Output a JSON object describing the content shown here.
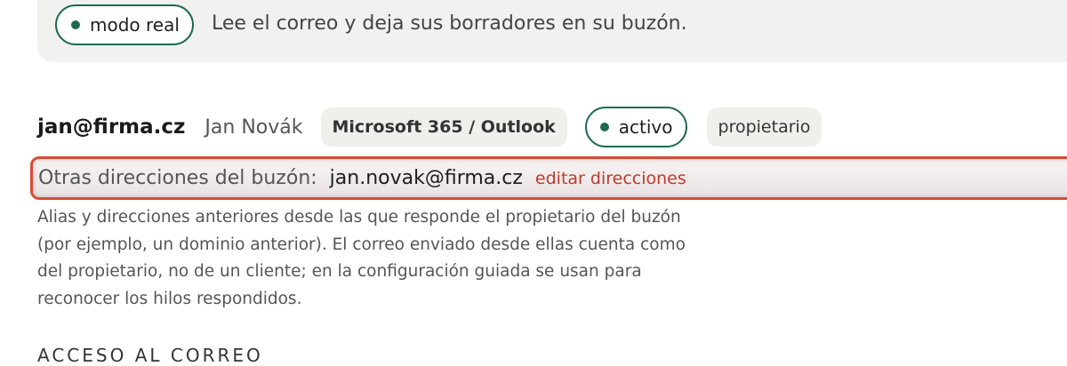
{
  "banner": {
    "mode_label": "modo real",
    "description": "Lee el correo y deja sus borradores en su buzón."
  },
  "account": {
    "email": "jan@firma.cz",
    "owner_name": "Jan Novák",
    "provider": "Microsoft 365 / Outlook",
    "status": "activo",
    "role": "propietario"
  },
  "aliases": {
    "label": "Otras direcciones del buzón:",
    "value": "jan.novak@firma.cz",
    "edit_label": "editar direcciones",
    "help_text": "Alias y direcciones anteriores desde las que responde el propietario del buzón (por ejemplo, un dominio anterior). El correo enviado desde ellas cuenta como del propietario, no de un cliente; en la configuración guiada se usan para reconocer los hilos respondidos."
  },
  "section": {
    "heading": "ACCESO AL CORREO"
  },
  "colors": {
    "accent_green": "#1d6b4f",
    "highlight_red": "#d84a35",
    "link_red": "#c0392b"
  }
}
